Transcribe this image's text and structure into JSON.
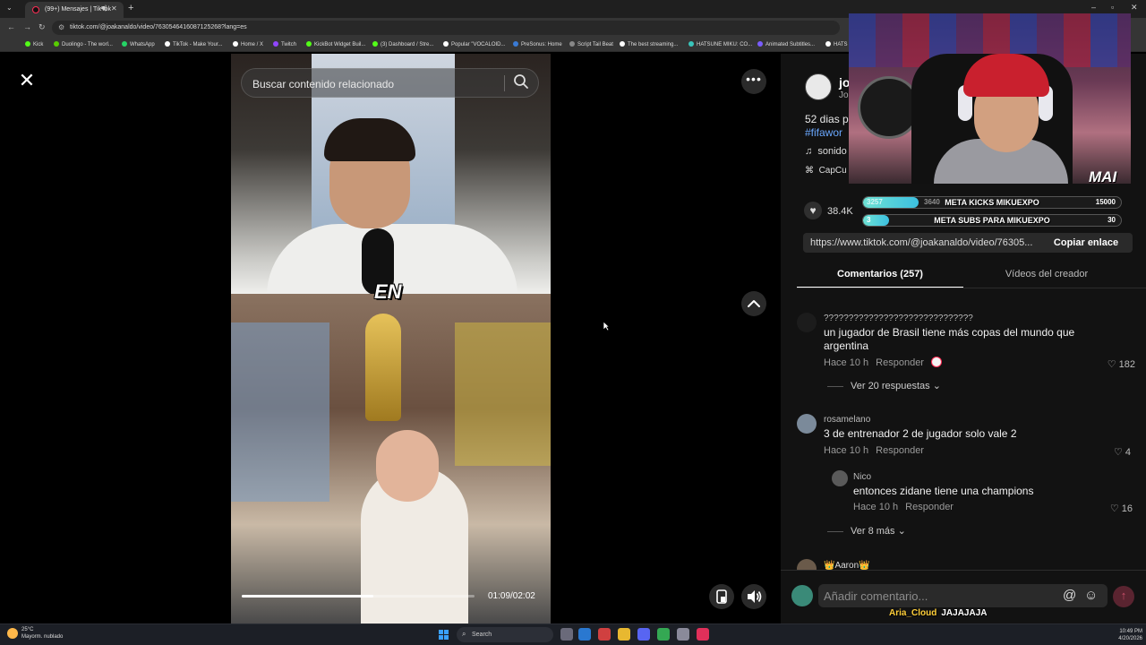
{
  "browser": {
    "tab_title": "(99+) Mensajes | TikTok",
    "url": "tiktok.com/@joakanaldo/video/7630546416087125268?lang=es",
    "bookmarks": [
      {
        "label": "Kick",
        "color": "#53fc18"
      },
      {
        "label": "Duolingo - The worl...",
        "color": "#58cc02"
      },
      {
        "label": "WhatsApp",
        "color": "#25d366"
      },
      {
        "label": "TikTok - Make Your...",
        "color": "#ffffff"
      },
      {
        "label": "Home / X",
        "color": "#ffffff"
      },
      {
        "label": "Twitch",
        "color": "#9146ff"
      },
      {
        "label": "KickBot Widget Buil...",
        "color": "#53fc18"
      },
      {
        "label": "(3) Dashboard / Stre...",
        "color": "#53fc18"
      },
      {
        "label": "Popular \"VOCALOID...",
        "color": "#ffffff"
      },
      {
        "label": "PreSonus: Home",
        "color": "#3a7bd5"
      },
      {
        "label": "Script Tail Beat",
        "color": "#888888"
      },
      {
        "label": "The best streaming...",
        "color": "#ffffff"
      },
      {
        "label": "HATSUNE MIKU: CO...",
        "color": "#39c5bb"
      },
      {
        "label": "Animated Subtitles...",
        "color": "#7a5cff"
      },
      {
        "label": "HATS",
        "color": "#ffffff"
      }
    ]
  },
  "video": {
    "search_placeholder": "Buscar contenido relacionado",
    "caption": "EN",
    "timecode": "01:09/02:02",
    "progress": 0.565
  },
  "post": {
    "username": "jo",
    "subname": "Jo",
    "description": "52 dias p",
    "hashtag": "#fifawor",
    "sound": "sonido",
    "capcut": "CapCu",
    "likes": "38.4K",
    "share_url": "https://www.tiktok.com/@joakanaldo/video/76305...",
    "copy_label": "Copiar enlace"
  },
  "tabs": {
    "comments": "Comentarios (257)",
    "creator_videos": "Vídeos del creador"
  },
  "comments": [
    {
      "user": "??????????????????????????????",
      "text": "un jugador de Brasil tiene más copas del mundo que argentina",
      "time": "Hace 10 h",
      "reply": "Responder",
      "likes": "182",
      "more": "Ver 20 respuestas"
    },
    {
      "user": "rosamelano",
      "text": "3 de entrenador 2 de jugador solo vale 2",
      "time": "Hace 10 h",
      "reply": "Responder",
      "likes": "4"
    },
    {
      "user": "Nico",
      "text": "entonces zidane tiene una champions",
      "time": "Hace 10 h",
      "reply": "Responder",
      "likes": "16",
      "more": "Ver 8 más"
    },
    {
      "user": "👑Aaron👑"
    }
  ],
  "comment_input": {
    "placeholder": "Añadir comentario..."
  },
  "stream_chat": {
    "user": "Aria_Cloud",
    "message": "JAJAJAJA"
  },
  "webcam": {
    "brand": "MAI",
    "goal_kicks": {
      "label": "META KICKS MIKUEXPO",
      "current": "3257",
      "target": "15000",
      "progress": 0.217,
      "mid": "3640"
    },
    "goal_subs": {
      "label": "META SUBS PARA MIKUEXPO",
      "current": "3",
      "target": "30",
      "progress": 0.1
    }
  },
  "taskbar": {
    "temperature": "25°C",
    "weather": "Mayorm. nublado",
    "search": "Search",
    "time": "10:49 PM",
    "date": "4/20/2026"
  }
}
